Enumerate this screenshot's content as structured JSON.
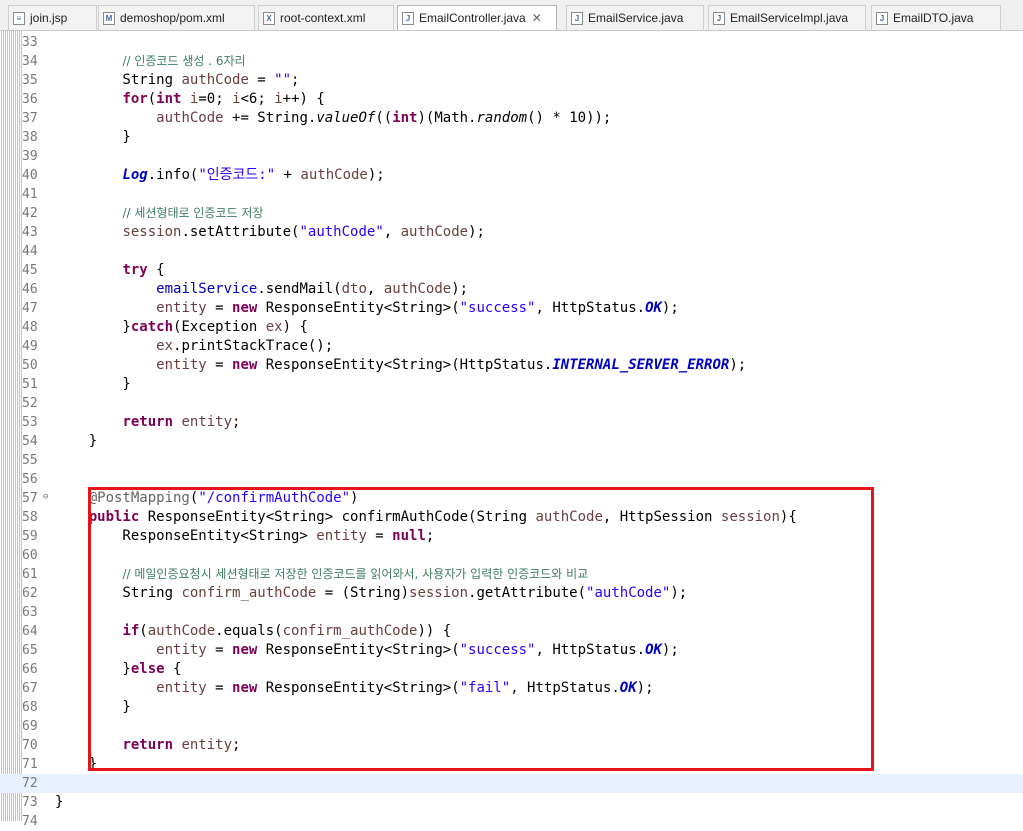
{
  "tabs": [
    {
      "label": "join.jsp",
      "icon": "jsp-file-icon",
      "glyph": "≡",
      "active": false
    },
    {
      "label": "demoshop/pom.xml",
      "icon": "maven-file-icon",
      "glyph": "M",
      "active": false
    },
    {
      "label": "root-context.xml",
      "icon": "xml-file-icon",
      "glyph": "X",
      "active": false
    },
    {
      "label": "EmailController.java",
      "icon": "java-file-icon",
      "glyph": "J",
      "active": true,
      "close": "✕"
    },
    {
      "label": "EmailService.java",
      "icon": "java-file-icon",
      "glyph": "J",
      "active": false
    },
    {
      "label": "EmailServiceImpl.java",
      "icon": "java-file-icon",
      "glyph": "J",
      "active": false
    },
    {
      "label": "EmailDTO.java",
      "icon": "java-file-icon",
      "glyph": "J",
      "active": false
    }
  ],
  "editor": {
    "current_line": 72,
    "fold_marker_line": 57,
    "lines": [
      {
        "n": "33",
        "code": []
      },
      {
        "n": "34",
        "code": [
          {
            "t": "        "
          },
          {
            "t": "// 인증코드 생성 . 6자리",
            "c": "cmt"
          }
        ]
      },
      {
        "n": "35",
        "code": [
          {
            "t": "        String "
          },
          {
            "t": "authCode",
            "c": "var"
          },
          {
            "t": " = "
          },
          {
            "t": "\"\"",
            "c": "str"
          },
          {
            "t": ";"
          }
        ]
      },
      {
        "n": "36",
        "code": [
          {
            "t": "        "
          },
          {
            "t": "for",
            "c": "kw"
          },
          {
            "t": "("
          },
          {
            "t": "int",
            "c": "kw"
          },
          {
            "t": " "
          },
          {
            "t": "i",
            "c": "var"
          },
          {
            "t": "=0; "
          },
          {
            "t": "i",
            "c": "var"
          },
          {
            "t": "<6; "
          },
          {
            "t": "i",
            "c": "var"
          },
          {
            "t": "++) {"
          }
        ]
      },
      {
        "n": "37",
        "code": [
          {
            "t": "            "
          },
          {
            "t": "authCode",
            "c": "var"
          },
          {
            "t": " += String."
          },
          {
            "t": "valueOf",
            "c": "smth"
          },
          {
            "t": "(("
          },
          {
            "t": "int",
            "c": "kw"
          },
          {
            "t": ")(Math."
          },
          {
            "t": "random",
            "c": "smth"
          },
          {
            "t": "() * 10));"
          }
        ]
      },
      {
        "n": "38",
        "code": [
          {
            "t": "        }"
          }
        ]
      },
      {
        "n": "39",
        "code": []
      },
      {
        "n": "40",
        "code": [
          {
            "t": "        "
          },
          {
            "t": "Log",
            "c": "sfld"
          },
          {
            "t": ".info("
          },
          {
            "t": "\"인증코드:\"",
            "c": "str"
          },
          {
            "t": " + "
          },
          {
            "t": "authCode",
            "c": "var"
          },
          {
            "t": ");"
          }
        ]
      },
      {
        "n": "41",
        "code": []
      },
      {
        "n": "42",
        "code": [
          {
            "t": "        "
          },
          {
            "t": "// 세션형태로 인증코드 저장",
            "c": "cmt"
          }
        ]
      },
      {
        "n": "43",
        "code": [
          {
            "t": "        "
          },
          {
            "t": "session",
            "c": "var"
          },
          {
            "t": ".setAttribute("
          },
          {
            "t": "\"authCode\"",
            "c": "str"
          },
          {
            "t": ", "
          },
          {
            "t": "authCode",
            "c": "var"
          },
          {
            "t": ");"
          }
        ]
      },
      {
        "n": "44",
        "code": []
      },
      {
        "n": "45",
        "code": [
          {
            "t": "        "
          },
          {
            "t": "try",
            "c": "kw"
          },
          {
            "t": " {"
          }
        ]
      },
      {
        "n": "46",
        "code": [
          {
            "t": "            "
          },
          {
            "t": "emailService",
            "c": "fld"
          },
          {
            "t": ".sendMail("
          },
          {
            "t": "dto",
            "c": "var"
          },
          {
            "t": ", "
          },
          {
            "t": "authCode",
            "c": "var"
          },
          {
            "t": ");"
          }
        ]
      },
      {
        "n": "47",
        "code": [
          {
            "t": "            "
          },
          {
            "t": "entity",
            "c": "var"
          },
          {
            "t": " = "
          },
          {
            "t": "new",
            "c": "kw"
          },
          {
            "t": " ResponseEntity<String>("
          },
          {
            "t": "\"success\"",
            "c": "str"
          },
          {
            "t": ", HttpStatus."
          },
          {
            "t": "OK",
            "c": "sfld"
          },
          {
            "t": ");"
          }
        ]
      },
      {
        "n": "48",
        "code": [
          {
            "t": "        }"
          },
          {
            "t": "catch",
            "c": "kw"
          },
          {
            "t": "(Exception "
          },
          {
            "t": "ex",
            "c": "var"
          },
          {
            "t": ") {"
          }
        ]
      },
      {
        "n": "49",
        "code": [
          {
            "t": "            "
          },
          {
            "t": "ex",
            "c": "var"
          },
          {
            "t": ".printStackTrace();"
          }
        ]
      },
      {
        "n": "50",
        "code": [
          {
            "t": "            "
          },
          {
            "t": "entity",
            "c": "var"
          },
          {
            "t": " = "
          },
          {
            "t": "new",
            "c": "kw"
          },
          {
            "t": " ResponseEntity<String>(HttpStatus."
          },
          {
            "t": "INTERNAL_SERVER_ERROR",
            "c": "sfld"
          },
          {
            "t": ");"
          }
        ]
      },
      {
        "n": "51",
        "code": [
          {
            "t": "        }"
          }
        ]
      },
      {
        "n": "52",
        "code": []
      },
      {
        "n": "53",
        "code": [
          {
            "t": "        "
          },
          {
            "t": "return",
            "c": "kw"
          },
          {
            "t": " "
          },
          {
            "t": "entity",
            "c": "var"
          },
          {
            "t": ";"
          }
        ]
      },
      {
        "n": "54",
        "code": [
          {
            "t": "    }"
          }
        ]
      },
      {
        "n": "55",
        "code": []
      },
      {
        "n": "56",
        "code": []
      },
      {
        "n": "57",
        "code": [
          {
            "t": "    "
          },
          {
            "t": "@PostMapping",
            "c": "ann"
          },
          {
            "t": "("
          },
          {
            "t": "\"/confirmAuthCode\"",
            "c": "str"
          },
          {
            "t": ")"
          }
        ]
      },
      {
        "n": "58",
        "code": [
          {
            "t": "    "
          },
          {
            "t": "public",
            "c": "kw"
          },
          {
            "t": " ResponseEntity<String> confirmAuthCode(String "
          },
          {
            "t": "authCode",
            "c": "var"
          },
          {
            "t": ", HttpSession "
          },
          {
            "t": "session",
            "c": "var"
          },
          {
            "t": "){"
          }
        ]
      },
      {
        "n": "59",
        "code": [
          {
            "t": "        ResponseEntity<String> "
          },
          {
            "t": "entity",
            "c": "var"
          },
          {
            "t": " = "
          },
          {
            "t": "null",
            "c": "kw"
          },
          {
            "t": ";"
          }
        ]
      },
      {
        "n": "60",
        "code": []
      },
      {
        "n": "61",
        "code": [
          {
            "t": "        "
          },
          {
            "t": "// 메일인증요청시 세션형태로 저장한 인증코드를 읽어와서, 사용자가 입력한 인증코드와 비교",
            "c": "cmt"
          }
        ]
      },
      {
        "n": "62",
        "code": [
          {
            "t": "        String "
          },
          {
            "t": "confirm_authCode",
            "c": "var"
          },
          {
            "t": " = (String)"
          },
          {
            "t": "session",
            "c": "var"
          },
          {
            "t": ".getAttribute("
          },
          {
            "t": "\"authCode\"",
            "c": "str"
          },
          {
            "t": ");"
          }
        ]
      },
      {
        "n": "63",
        "code": []
      },
      {
        "n": "64",
        "code": [
          {
            "t": "        "
          },
          {
            "t": "if",
            "c": "kw"
          },
          {
            "t": "("
          },
          {
            "t": "authCode",
            "c": "var"
          },
          {
            "t": ".equals("
          },
          {
            "t": "confirm_authCode",
            "c": "var"
          },
          {
            "t": ")) {"
          }
        ]
      },
      {
        "n": "65",
        "code": [
          {
            "t": "            "
          },
          {
            "t": "entity",
            "c": "var"
          },
          {
            "t": " = "
          },
          {
            "t": "new",
            "c": "kw"
          },
          {
            "t": " ResponseEntity<String>("
          },
          {
            "t": "\"success\"",
            "c": "str"
          },
          {
            "t": ", HttpStatus."
          },
          {
            "t": "OK",
            "c": "sfld"
          },
          {
            "t": ");"
          }
        ]
      },
      {
        "n": "66",
        "code": [
          {
            "t": "        }"
          },
          {
            "t": "else",
            "c": "kw"
          },
          {
            "t": " {"
          }
        ]
      },
      {
        "n": "67",
        "code": [
          {
            "t": "            "
          },
          {
            "t": "entity",
            "c": "var"
          },
          {
            "t": " = "
          },
          {
            "t": "new",
            "c": "kw"
          },
          {
            "t": " ResponseEntity<String>("
          },
          {
            "t": "\"fail\"",
            "c": "str"
          },
          {
            "t": ", HttpStatus."
          },
          {
            "t": "OK",
            "c": "sfld"
          },
          {
            "t": ");"
          }
        ]
      },
      {
        "n": "68",
        "code": [
          {
            "t": "        }"
          }
        ]
      },
      {
        "n": "69",
        "code": []
      },
      {
        "n": "70",
        "code": [
          {
            "t": "        "
          },
          {
            "t": "return",
            "c": "kw"
          },
          {
            "t": " "
          },
          {
            "t": "entity",
            "c": "var"
          },
          {
            "t": ";"
          }
        ]
      },
      {
        "n": "71",
        "code": [
          {
            "t": "    }"
          }
        ]
      },
      {
        "n": "72",
        "code": []
      },
      {
        "n": "73",
        "code": [
          {
            "t": "}"
          }
        ]
      },
      {
        "n": "74",
        "code": []
      }
    ]
  }
}
